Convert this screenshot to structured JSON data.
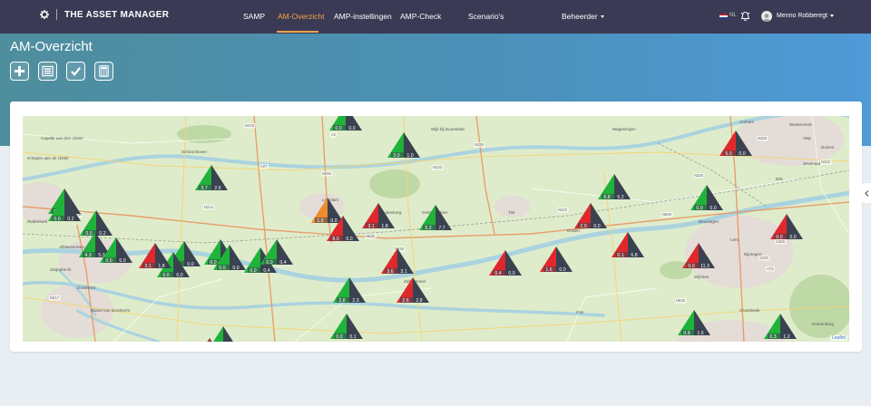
{
  "app": {
    "title": "THE ASSET MANAGER",
    "logo_icon": "gear-icon"
  },
  "nav": {
    "items": [
      {
        "label": "SAMP",
        "active": false
      },
      {
        "label": "AM-Overzicht",
        "active": true
      },
      {
        "label": "AMP-instellingen",
        "active": false
      },
      {
        "label": "AMP-Check",
        "active": false
      },
      {
        "label": "Scenario's",
        "active": false
      },
      {
        "label": "Beheerder",
        "active": false,
        "dropdown": true
      }
    ],
    "language": "NL",
    "user": "Menno Robberegt"
  },
  "page": {
    "title": "AM-Overzicht"
  },
  "toolbar": [
    {
      "name": "add-button",
      "icon": "plus-icon"
    },
    {
      "name": "list-button",
      "icon": "list-icon"
    },
    {
      "name": "check-button",
      "icon": "check-icon"
    },
    {
      "name": "calculator-button",
      "icon": "calculator-icon"
    }
  ],
  "map": {
    "attribution": "Leaflet",
    "places": [
      "Schoonhoven",
      "Krimpen aan de IJssel",
      "Capelle aan den IJssel",
      "Ridderkerk",
      "Alblasserdam",
      "Zwijndrecht",
      "Dordrecht",
      "Eiland van Dordrecht",
      "Wijk bij Duurstede",
      "Wageningen",
      "Arnhem",
      "Velp",
      "Westervoort",
      "Duiven",
      "Zevenaar",
      "Tiel",
      "Druten",
      "Beuningen",
      "Nijmegen",
      "Wijchen",
      "Oss",
      "Groesbeek",
      "Kranenburg",
      "Zaltbommel",
      "Leerdam",
      "Culemborg",
      "Geldermalsen",
      "Lent",
      "Elst"
    ],
    "roads": [
      "N210",
      "A27",
      "N484",
      "A2",
      "N229",
      "N233",
      "N320",
      "N322",
      "N323",
      "N325",
      "N839",
      "A15",
      "N830",
      "N848",
      "A73",
      "A325",
      "N217",
      "N3",
      "N214",
      "S100",
      "N845"
    ],
    "markers": [
      {
        "a": "0.0",
        "b": "0.0",
        "c": "green"
      },
      {
        "a": "3.0",
        "b": "1.0",
        "c": "green"
      },
      {
        "a": "0.0",
        "b": "0.1",
        "c": "green"
      },
      {
        "a": "0.0",
        "b": "0.1",
        "c": "green"
      },
      {
        "a": "0.4",
        "b": "0.4",
        "c": "orange"
      },
      {
        "a": "0.0",
        "b": "1.1",
        "c": "red"
      },
      {
        "a": "3.7",
        "b": "2.6",
        "c": "green"
      },
      {
        "a": "0.0",
        "b": "0.0",
        "c": "green"
      },
      {
        "a": "0.0",
        "b": "0.2",
        "c": "green"
      },
      {
        "a": "0.0",
        "b": "0.2",
        "c": "green"
      },
      {
        "a": "4.3",
        "b": "5.3",
        "c": "green"
      },
      {
        "a": "0.0",
        "b": "0.0",
        "c": "green"
      },
      {
        "a": "0.0",
        "b": "0.0",
        "c": "green"
      },
      {
        "a": "1.9",
        "b": "0.0",
        "c": "orange"
      },
      {
        "a": "8.0",
        "b": "0.0",
        "c": "red"
      },
      {
        "a": "3.1",
        "b": "1.8",
        "c": "red"
      },
      {
        "a": "5.2",
        "b": "7.7",
        "c": "green"
      },
      {
        "a": "3.6",
        "b": "3.1",
        "c": "red"
      },
      {
        "a": "0.0",
        "b": "0.0",
        "c": "green"
      },
      {
        "a": "0.0",
        "b": "0.0",
        "c": "green"
      },
      {
        "a": "0.0",
        "b": "0.0",
        "c": "green"
      },
      {
        "a": "3.1",
        "b": "1.8",
        "c": "red"
      },
      {
        "a": "0.0",
        "b": "0.4",
        "c": "green"
      },
      {
        "a": "0.0",
        "b": "0.4",
        "c": "green"
      },
      {
        "a": "0.4",
        "b": "0.0",
        "c": "red"
      },
      {
        "a": "1.6",
        "b": "0.0",
        "c": "red"
      },
      {
        "a": "2.0",
        "b": "0.0",
        "c": "red"
      },
      {
        "a": "0.1",
        "b": "6.8",
        "c": "red"
      },
      {
        "a": "0.0",
        "b": "11.3",
        "c": "red"
      },
      {
        "a": "6.8",
        "b": "5.2",
        "c": "green"
      },
      {
        "a": "5.0",
        "b": "0.0",
        "c": "red"
      },
      {
        "a": "0.0",
        "b": "0.0",
        "c": "green"
      },
      {
        "a": "0.0",
        "b": "0.0",
        "c": "red"
      },
      {
        "a": "2.8",
        "b": "2.3",
        "c": "green"
      },
      {
        "a": "2.6",
        "b": "2.8",
        "c": "red"
      },
      {
        "a": "0.0",
        "b": "0.1",
        "c": "green"
      },
      {
        "a": "0.9",
        "b": "1.6",
        "c": "green"
      },
      {
        "a": "0.3",
        "b": "1.2",
        "c": "green"
      }
    ]
  }
}
